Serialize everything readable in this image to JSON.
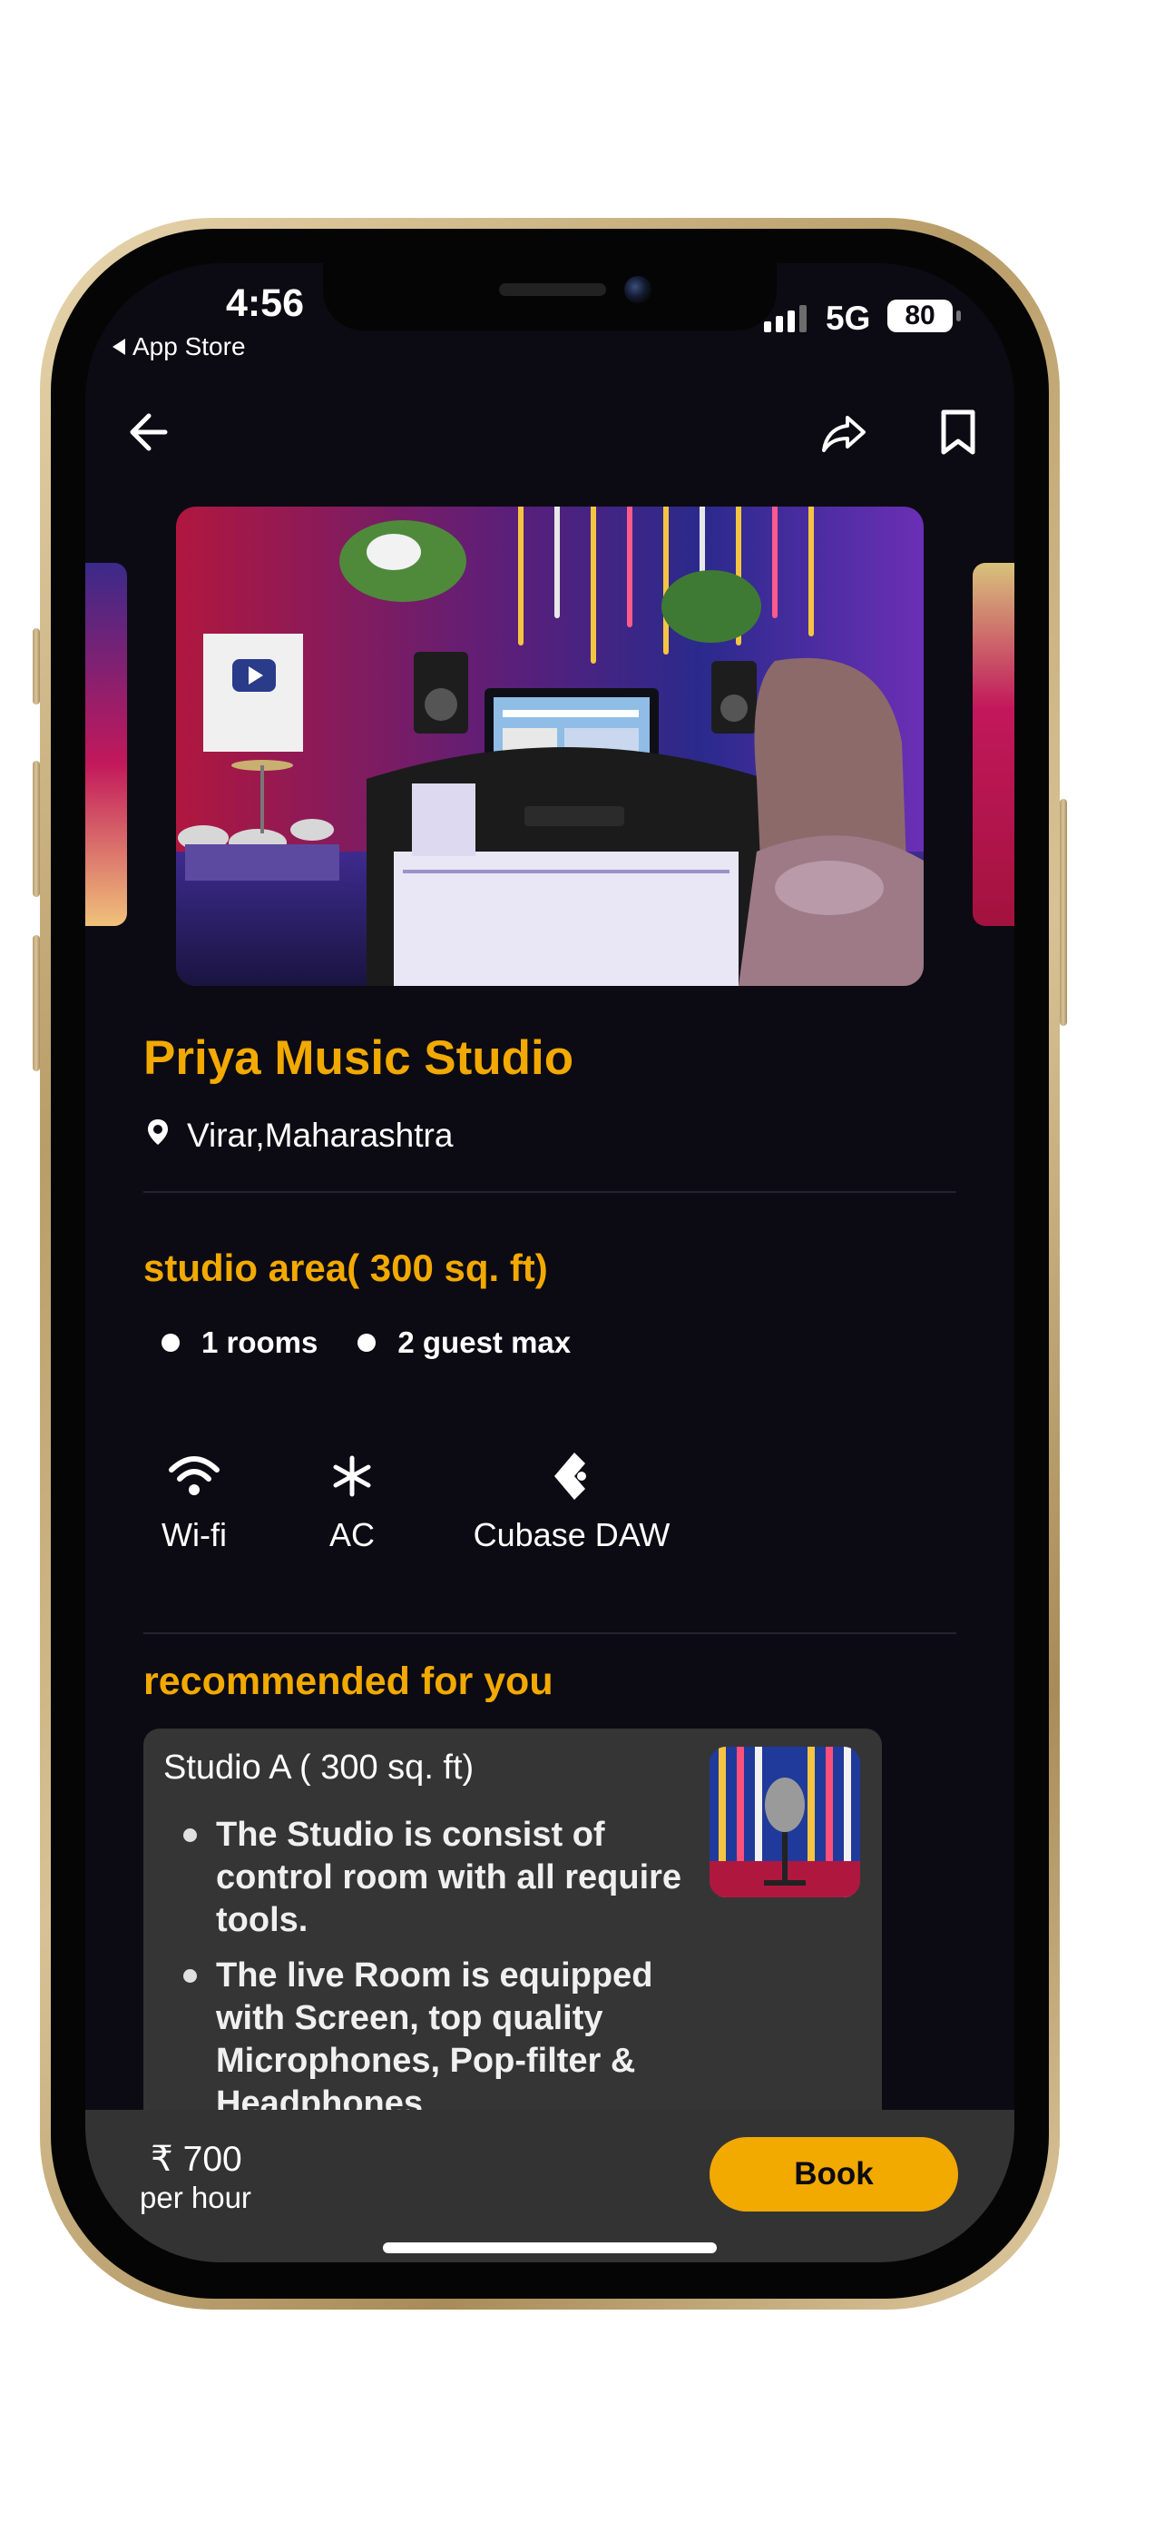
{
  "status_bar": {
    "time": "4:56",
    "back_label": "App Store",
    "network": "5G",
    "battery": "80"
  },
  "nav": {
    "back_icon": "arrow-left-icon",
    "share_icon": "share-icon",
    "bookmark_icon": "bookmark-icon"
  },
  "studio": {
    "name": "Priya Music Studio",
    "location": "Virar,Maharashtra",
    "area_title": "studio area( 300 sq. ft)",
    "stats": [
      "1 rooms",
      "2 guest max"
    ],
    "amenities": [
      {
        "label": "Wi-fi",
        "icon": "wifi-icon"
      },
      {
        "label": "AC",
        "icon": "snowflake-icon"
      },
      {
        "label": "Cubase DAW",
        "icon": "cubase-icon"
      }
    ]
  },
  "recommended": {
    "title": "recommended for you",
    "card_title": "Studio A ( 300 sq. ft)",
    "bullets": [
      "The Studio is consist of control room with all require tools.",
      "The live Room is equipped with Screen, top quality Microphones, Pop-filter & Headphones"
    ]
  },
  "booking": {
    "price": "₹ 700",
    "unit": "per hour",
    "button": "Book"
  },
  "colors": {
    "accent": "#f2a900",
    "background": "#0c0b13",
    "card": "#353535"
  }
}
